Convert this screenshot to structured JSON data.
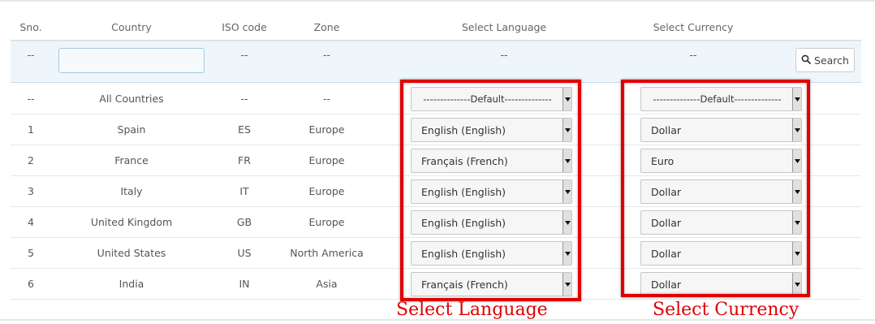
{
  "headers": {
    "sno": "Sno.",
    "country": "Country",
    "iso": "ISO code",
    "zone": "Zone",
    "language": "Select Language",
    "currency": "Select Currency"
  },
  "filter": {
    "sno": "--",
    "country_value": "",
    "iso": "--",
    "zone": "--",
    "language": "--",
    "currency": "--",
    "search_label": "Search"
  },
  "rows": [
    {
      "sno": "--",
      "country": "All Countries",
      "iso": "--",
      "zone": "--",
      "language": "--------------Default--------------",
      "currency": "--------------Default--------------"
    },
    {
      "sno": "1",
      "country": "Spain",
      "iso": "ES",
      "zone": "Europe",
      "language": "English (English)",
      "currency": "Dollar"
    },
    {
      "sno": "2",
      "country": "France",
      "iso": "FR",
      "zone": "Europe",
      "language": "Français (French)",
      "currency": "Euro"
    },
    {
      "sno": "3",
      "country": "Italy",
      "iso": "IT",
      "zone": "Europe",
      "language": "English (English)",
      "currency": "Dollar"
    },
    {
      "sno": "4",
      "country": "United Kingdom",
      "iso": "GB",
      "zone": "Europe",
      "language": "English (English)",
      "currency": "Dollar"
    },
    {
      "sno": "5",
      "country": "United States",
      "iso": "US",
      "zone": "North America",
      "language": "English (English)",
      "currency": "Dollar"
    },
    {
      "sno": "6",
      "country": "India",
      "iso": "IN",
      "zone": "Asia",
      "language": "Français (French)",
      "currency": "Dollar"
    }
  ],
  "annotations": {
    "language": "Select Language",
    "currency": "Select Currency"
  },
  "icons": {
    "search": "search-icon",
    "dropdown": "chevron-down-icon"
  },
  "colors": {
    "annotation_red": "#e00000",
    "filter_row_bg": "#eef6fb"
  }
}
